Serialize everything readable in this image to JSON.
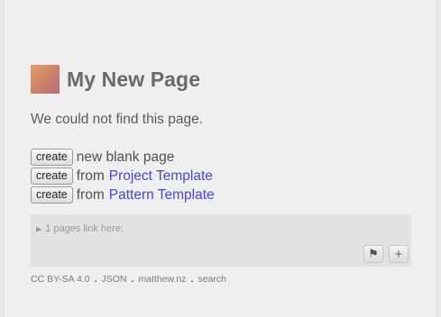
{
  "page": {
    "title": "My New Page",
    "message": "We could not find this page."
  },
  "options": [
    {
      "button": "create",
      "prefix": "new blank page",
      "link": ""
    },
    {
      "button": "create",
      "prefix": "from",
      "link": "Project Template"
    },
    {
      "button": "create",
      "prefix": "from",
      "link": "Pattern Template"
    }
  ],
  "backlinks": {
    "label": "1 pages link here:"
  },
  "controls": {
    "flag_icon": "flag-icon",
    "add_icon": "plus-icon",
    "flag_glyph": "⚑",
    "add_glyph": "+"
  },
  "footer": {
    "license": "CC BY-SA 4.0",
    "json": "JSON",
    "site": "matthew.nz",
    "search": "search",
    "separator": "."
  },
  "colors": {
    "link": "#4646d8",
    "text": "#5a5a5a",
    "panel": "#e2e2e2"
  }
}
